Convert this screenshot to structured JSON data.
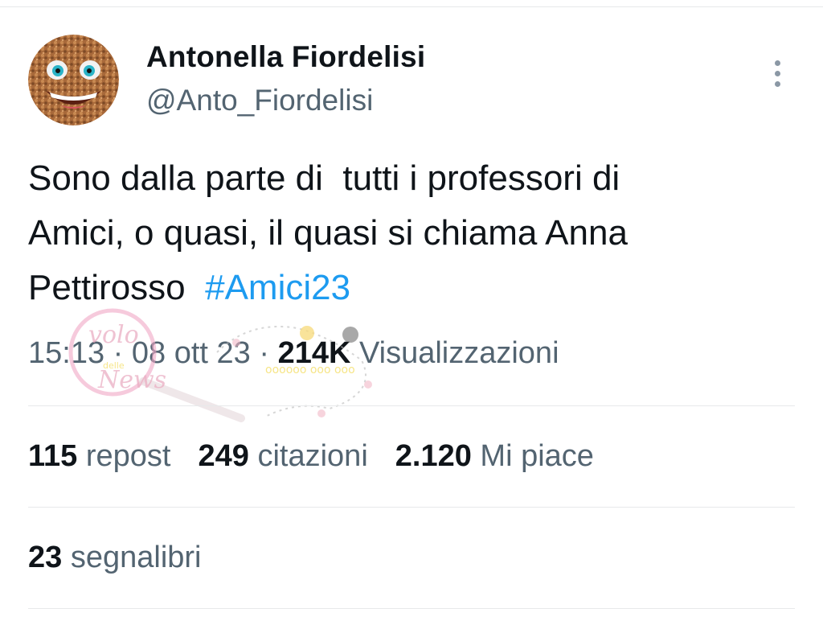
{
  "tweet": {
    "author_name": "Antonella Fiordelisi",
    "author_handle": "@Anto_Fiordelisi",
    "text": "Sono dalla parte di  tutti i professori di\nAmici, o quasi, il quasi si chiama Anna\nPettirosso  ",
    "hashtag": "#Amici23",
    "time": "15:13",
    "date": "08 ott 23",
    "separator": " · ",
    "views_count": "214K",
    "views_label": "Visualizzazioni"
  },
  "stats": {
    "reposts_count": "115",
    "reposts_label": "repost",
    "quotes_count": "249",
    "quotes_label": "citazioni",
    "likes_count": "2.120",
    "likes_label": "Mi piace",
    "bookmarks_count": "23",
    "bookmarks_label": "segnalibri"
  },
  "icons": {
    "more": "more-vertical-icon",
    "avatar": "avatar-emoji"
  },
  "colors": {
    "text": "#0f1419",
    "secondary": "#536471",
    "link": "#1d9bf0",
    "divider": "#e7e9ea"
  }
}
